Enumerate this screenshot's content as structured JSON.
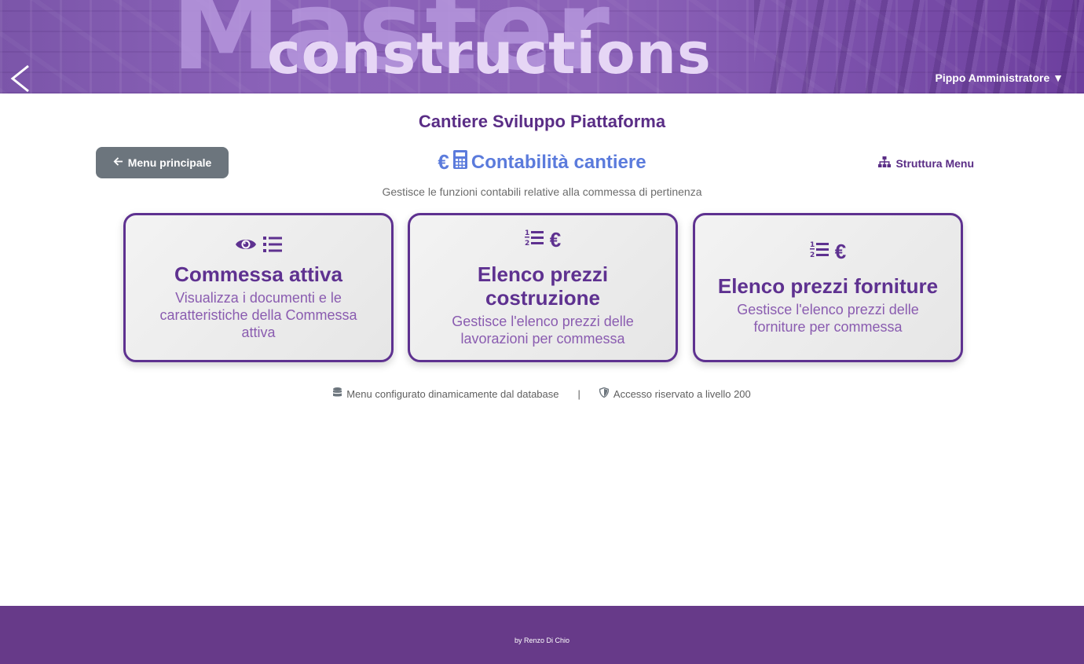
{
  "header": {
    "logo_main": "Master",
    "logo_sub": "constructions",
    "user_menu": "Pippo Amministratore ▼"
  },
  "page": {
    "site_title": "Cantiere Sviluppo Piattaforma",
    "main_menu_button": "Menu principale",
    "section_title": "Contabilità cantiere",
    "structure_menu": "Struttura Menu",
    "subtitle": "Gestisce le funzioni contabili relative alla commessa di pertinenza"
  },
  "cards": [
    {
      "title": "Commessa attiva",
      "description": "Visualizza i documenti e le caratteristiche della Commessa attiva",
      "icons": [
        "eye-icon",
        "list-icon"
      ]
    },
    {
      "title": "Elenco prezzi costruzione",
      "description": "Gestisce l'elenco prezzi delle lavorazioni per commessa",
      "icons": [
        "numbered-list-icon",
        "euro-icon"
      ]
    },
    {
      "title": "Elenco prezzi forniture",
      "description": "Gestisce l'elenco prezzi delle forniture per commessa",
      "icons": [
        "numbered-list-icon",
        "euro-icon"
      ]
    }
  ],
  "info": {
    "database_note": "Menu configurato dinamicamente dal database",
    "separator": "|",
    "access_note": "Accesso riservato a livello 200"
  },
  "footer": {
    "credit": "by Renzo Di Chio"
  },
  "colors": {
    "brand_purple": "#5e3190",
    "section_blue": "#5b7bdc",
    "footer_bg": "#673a89",
    "button_gray": "#6c757d"
  }
}
